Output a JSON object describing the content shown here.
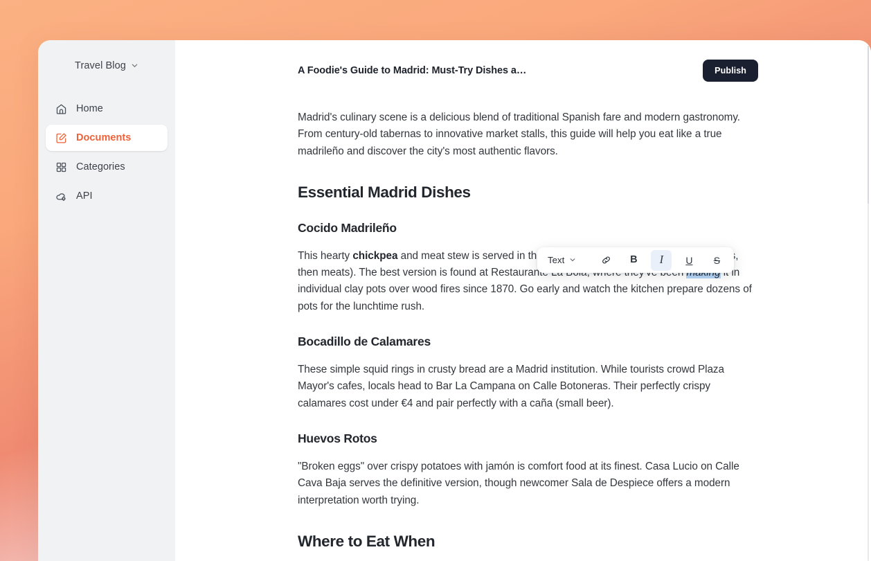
{
  "theme": {
    "accent": "#ee6239",
    "publish_bg": "#1b2030",
    "sidebar_bg": "#f1f2f4",
    "selection_highlight": "#b5d5f6",
    "bg_gradient_start": "#fbb183",
    "bg_gradient_end": "#e06360"
  },
  "sidebar": {
    "workspace": {
      "name": "Travel Blog",
      "chevron_icon": "chevron-down-icon"
    },
    "items": [
      {
        "label": "Home",
        "icon": "home-icon",
        "active": false
      },
      {
        "label": "Documents",
        "icon": "document-edit-icon",
        "active": true
      },
      {
        "label": "Categories",
        "icon": "grid-icon",
        "active": false
      },
      {
        "label": "API",
        "icon": "cloud-cog-icon",
        "active": false
      }
    ]
  },
  "header": {
    "document_title": "A Foodie's Guide to Madrid: Must-Try Dishes a…",
    "publish_label": "Publish"
  },
  "toolbar": {
    "style_label": "Text",
    "style_chevron_icon": "chevron-down-icon",
    "buttons": [
      {
        "name": "link",
        "glyph": "link-icon",
        "label": "",
        "active": false
      },
      {
        "name": "bold",
        "glyph": "bold-icon",
        "label": "B",
        "active": false
      },
      {
        "name": "italic",
        "glyph": "italic-icon",
        "label": "I",
        "active": true
      },
      {
        "name": "underline",
        "glyph": "underline-icon",
        "label": "U",
        "active": false
      },
      {
        "name": "strikethrough",
        "glyph": "strikethrough-icon",
        "label": "S",
        "active": false
      }
    ]
  },
  "document": {
    "intro": "Madrid's culinary scene is a delicious blend of traditional Spanish fare and modern gastronomy. From century-old tabernas to innovative market stalls, this guide will help you eat like a true madrileño and discover the city's most authentic flavors.",
    "heading_essential": "Essential Madrid Dishes",
    "sections": [
      {
        "heading": "Cocido Madrileño",
        "body_pre_bold": "This hearty ",
        "body_bold": "chickpea",
        "body_obscured_1": " and meat stew is se",
        "body_mid_1": "rved in three parts (soup, chickpeas wit",
        "body_obscured_2": "h vegetables, then meats). The best version",
        "body_mid_2": " is found at Restaurante La Bola, where they've been ",
        "body_selected": "making",
        "body_tail": " it in individual clay pots over wood fires since 1870. Go early and watch the kitchen prepare dozens of pots for the lunchtime rush."
      },
      {
        "heading": "Bocadillo de Calamares",
        "body": "These simple squid rings in crusty bread are a Madrid institution. While tourists crowd Plaza Mayor's cafes, locals head to Bar La Campana on Calle Botoneras. Their perfectly crispy calamares cost under €4 and pair perfectly with a caña (small beer)."
      },
      {
        "heading": "Huevos Rotos",
        "body": "\"Broken eggs\" over crispy potatoes with jamón is comfort food at its finest. Casa Lucio on Calle Cava Baja serves the definitive version, though newcomer Sala de Despiece offers a modern interpretation worth trying."
      }
    ],
    "heading_where": "Where to Eat When"
  }
}
